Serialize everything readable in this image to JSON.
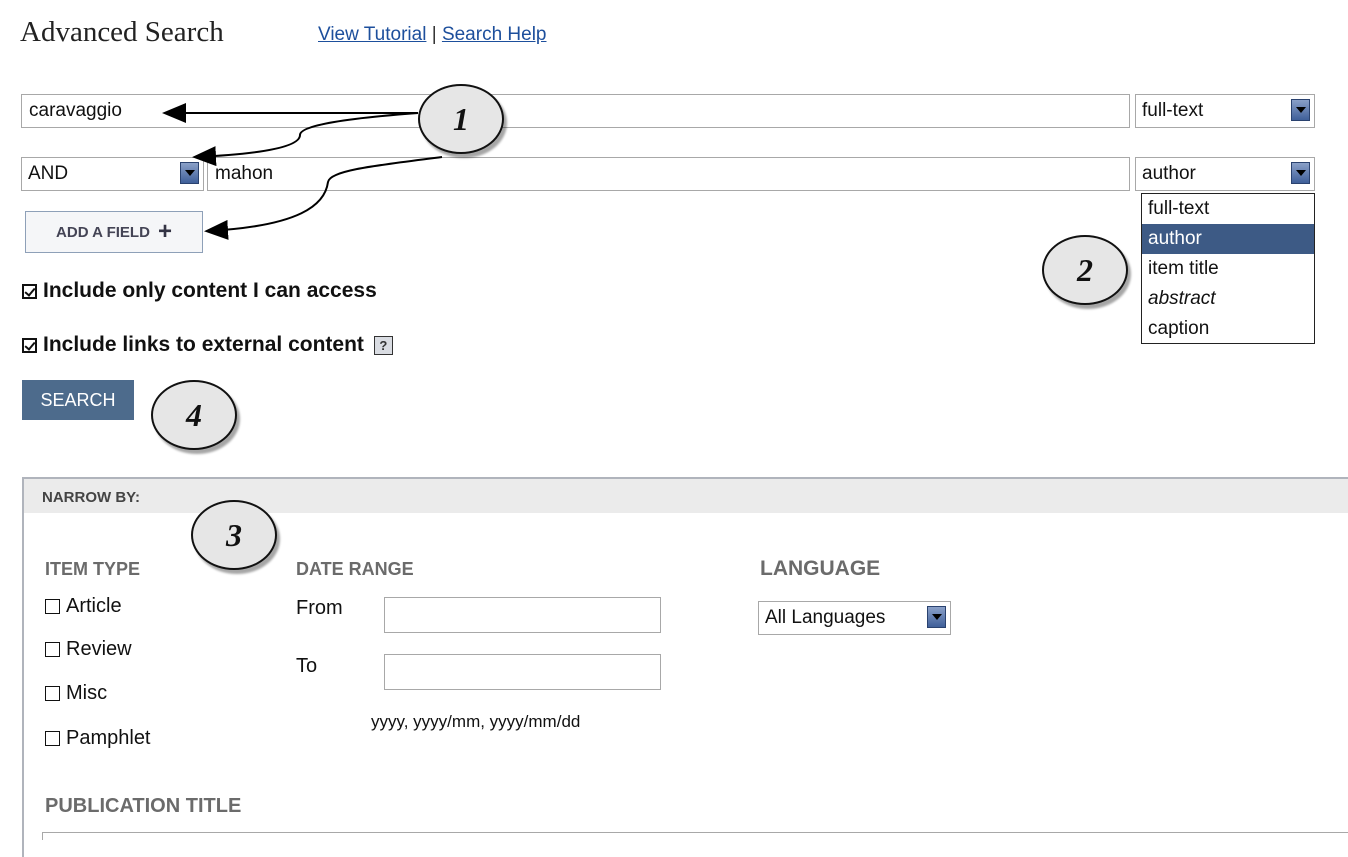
{
  "header": {
    "title": "Advanced Search",
    "links": [
      "View Tutorial",
      "Search Help"
    ],
    "separator": "|"
  },
  "search_rows": [
    {
      "value": "caravaggio",
      "field": "full-text"
    },
    {
      "operator": "AND",
      "value": "mahon",
      "field": "author"
    }
  ],
  "add_field_label": "ADD A FIELD",
  "add_field_icon": "plus-icon",
  "field_dropdown_options": [
    "full-text",
    "author",
    "item title",
    "abstract",
    "caption"
  ],
  "field_dropdown_selected": "author",
  "options": {
    "only_accessible": "Include only content I can access",
    "external_links": "Include links to external content",
    "only_accessible_checked": true,
    "external_links_checked": true,
    "help_icon": "?"
  },
  "search_button": "SEARCH",
  "narrow": {
    "title": "NARROW BY:",
    "item_type": {
      "heading": "ITEM TYPE",
      "items": [
        "Article",
        "Review",
        "Misc",
        "Pamphlet"
      ]
    },
    "date_range": {
      "heading": "DATE RANGE",
      "from_label": "From",
      "to_label": "To",
      "hint": "yyyy, yyyy/mm, yyyy/mm/dd"
    },
    "language": {
      "heading": "LANGUAGE",
      "selected": "All Languages"
    },
    "publication_title": {
      "heading": "PUBLICATION TITLE"
    }
  },
  "callouts": [
    "1",
    "2",
    "3",
    "4"
  ],
  "colors": {
    "link": "#1d4f9c",
    "button": "#4d6b8c",
    "selected_option": "#3d5a85",
    "heading_gray": "#6b6b6b"
  }
}
